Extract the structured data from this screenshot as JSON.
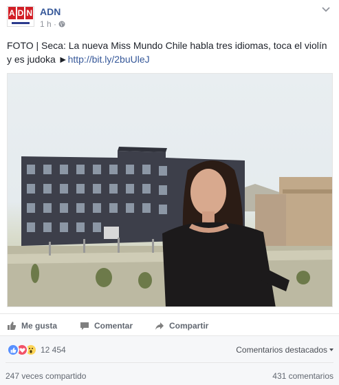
{
  "post": {
    "logo": {
      "top_text": [
        "A",
        "D",
        "N"
      ],
      "brand_red": "#d21f26",
      "brand_blue": "#2b3a8c"
    },
    "page_name": "ADN",
    "time": "1 h ·",
    "privacy_icon": "globe-icon",
    "options_icon": "chevron-down-icon",
    "text": {
      "body": "FOTO | Seca: La nueva Miss Mundo Chile habla tres idiomas, toca el violín y es judoka ►",
      "link": "http://bit.ly/2buUleJ"
    }
  },
  "actions": {
    "like": "Me gusta",
    "comment": "Comentar",
    "share": "Compartir"
  },
  "summary": {
    "reactions": [
      "like",
      "love",
      "wow"
    ],
    "reaction_count": "12 454",
    "top_comments": "Comentarios destacados",
    "shares": "247 veces compartido",
    "comments": "431 comentarios"
  },
  "colors": {
    "link": "#365899",
    "secondary": "#616770",
    "bg_summary": "#f6f7f9"
  }
}
